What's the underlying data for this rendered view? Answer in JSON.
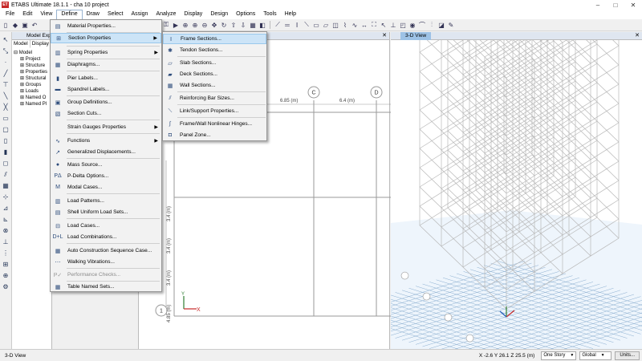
{
  "window": {
    "title": "ETABS Ultimate 18.1.1 - cha 10 project",
    "logo": "ETABS"
  },
  "menubar": [
    "File",
    "Edit",
    "View",
    "Define",
    "Draw",
    "Select",
    "Assign",
    "Analyze",
    "Display",
    "Design",
    "Options",
    "Tools",
    "Help"
  ],
  "explorer": {
    "title": "Model Exp",
    "tabs": [
      "Model",
      "Display"
    ],
    "tree": [
      "Model",
      "Project",
      "Structure",
      "Properties",
      "Structural",
      "Groups",
      "Loads",
      "Named O",
      "Named Pl"
    ]
  },
  "define_menu": {
    "items": [
      {
        "label": "Material Properties...",
        "icon": "material-icon"
      },
      {
        "label": "Section Properties",
        "icon": "section-icon",
        "submenu": true,
        "highlighted": true
      },
      {
        "label": "Spring Properties",
        "icon": "spring-icon",
        "submenu": true
      },
      {
        "label": "Diaphragms...",
        "icon": "diaphragm-icon"
      },
      {
        "label": "Pier Labels...",
        "icon": "pier-icon"
      },
      {
        "label": "Spandrel Labels...",
        "icon": "spandrel-icon"
      },
      {
        "label": "Group Definitions...",
        "icon": "group-icon"
      },
      {
        "label": "Section Cuts...",
        "icon": "section-cut-icon"
      },
      {
        "label": "Strain Gauges Properties",
        "icon": "",
        "submenu": true
      },
      {
        "label": "Functions",
        "icon": "function-icon",
        "submenu": true
      },
      {
        "label": "Generalized Displacements...",
        "icon": "displacement-icon"
      },
      {
        "label": "Mass Source...",
        "icon": "mass-icon"
      },
      {
        "label": "P-Delta Options...",
        "icon": "pdelta-icon"
      },
      {
        "label": "Modal Cases...",
        "icon": "modal-icon"
      },
      {
        "label": "Load Patterns...",
        "icon": "load-pattern-icon"
      },
      {
        "label": "Shell Uniform Load Sets...",
        "icon": "shell-load-icon"
      },
      {
        "label": "Load Cases...",
        "icon": "load-case-icon"
      },
      {
        "label": "Load Combinations...",
        "icon": "load-combo-icon"
      },
      {
        "label": "Auto Construction Sequence Case...",
        "icon": "construction-icon"
      },
      {
        "label": "Walking Vibrations...",
        "icon": "walking-icon"
      },
      {
        "label": "Performance Checks...",
        "icon": "performance-icon",
        "disabled": true
      },
      {
        "label": "Table Named Sets...",
        "icon": "table-icon"
      }
    ]
  },
  "section_submenu": {
    "items": [
      {
        "label": "Frame Sections...",
        "icon": "frame-section-icon",
        "highlighted": true
      },
      {
        "label": "Tendon Sections...",
        "icon": "tendon-icon"
      },
      {
        "label": "Slab Sections...",
        "icon": "slab-icon"
      },
      {
        "label": "Deck Sections...",
        "icon": "deck-icon"
      },
      {
        "label": "Wall Sections...",
        "icon": "wall-icon"
      },
      {
        "label": "Reinforcing Bar Sizes...",
        "icon": "rebar-icon"
      },
      {
        "label": "Link/Support Properties...",
        "icon": "link-icon"
      },
      {
        "label": "Frame/Wall Nonlinear Hinges...",
        "icon": "hinge-icon"
      },
      {
        "label": "Panel Zone...",
        "icon": "panel-zone-icon"
      }
    ]
  },
  "plan_view": {
    "grid_bubbles": [
      "C",
      "D",
      "1"
    ],
    "dimensions_x": [
      "6.85 (m)",
      "6.4 (m)"
    ],
    "dimensions_y": [
      "3.4 (m)",
      "3.4 (m)",
      "3.4 (m)",
      "4.85 (m)"
    ],
    "axis_labels": [
      "Y",
      "X"
    ]
  },
  "view3d": {
    "tab": "3-D View",
    "close": "✕"
  },
  "plan_close": "✕",
  "statusbar": {
    "left": "3-D View",
    "coords": "X -2.6  Y 26.1  Z 25.5 (m)",
    "story": "One Story",
    "coord_sys": "Global",
    "units": "Units..."
  },
  "colors": {
    "menu_highlight": "#cce4f7",
    "view_tab": "#9dc2e6",
    "grid_3d": "#8aaed0",
    "frame_lines": "#b8b8b8"
  }
}
